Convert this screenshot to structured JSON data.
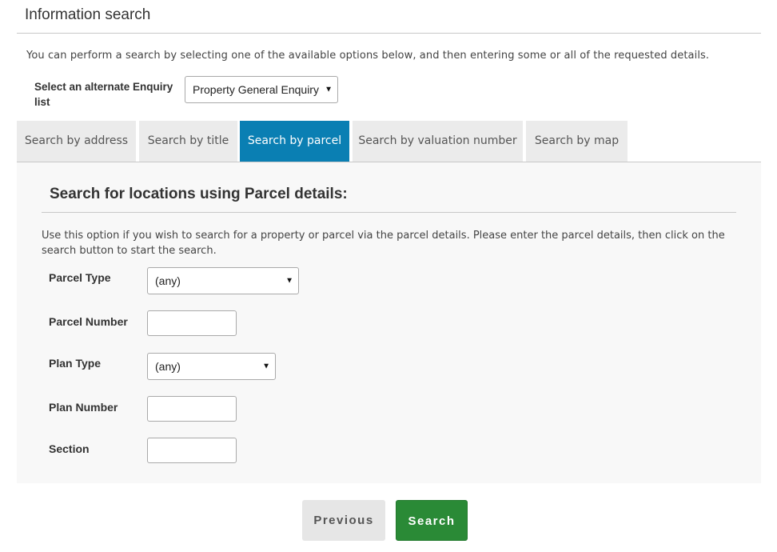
{
  "header": {
    "title": "Information search",
    "intro": "You can perform a search by selecting one of the available options below, and then entering some or all of the requested details."
  },
  "enquiry": {
    "label": "Select an alternate Enquiry list",
    "selected": "Property General Enquiry"
  },
  "tabs": [
    {
      "label": "Search by address",
      "active": false
    },
    {
      "label": "Search by title",
      "active": false
    },
    {
      "label": "Search by parcel",
      "active": true
    },
    {
      "label": "Search by valuation number",
      "active": false
    },
    {
      "label": "Search by map",
      "active": false
    }
  ],
  "panel": {
    "title": "Search for locations using Parcel details:",
    "description": "Use this option if you wish to search for a property or parcel via the parcel details. Please enter the parcel details, then click on the search button to start the search.",
    "fields": {
      "parcel_type": {
        "label": "Parcel Type",
        "value": "(any)"
      },
      "parcel_number": {
        "label": "Parcel Number",
        "value": ""
      },
      "plan_type": {
        "label": "Plan Type",
        "value": "(any)"
      },
      "plan_number": {
        "label": "Plan Number",
        "value": ""
      },
      "section": {
        "label": "Section",
        "value": ""
      }
    }
  },
  "buttons": {
    "previous": "Previous",
    "search": "Search"
  },
  "colors": {
    "active_tab": "#0a7fb3",
    "search_button": "#2a8a36"
  },
  "icons": {
    "dropdown": "caret-down-icon"
  }
}
